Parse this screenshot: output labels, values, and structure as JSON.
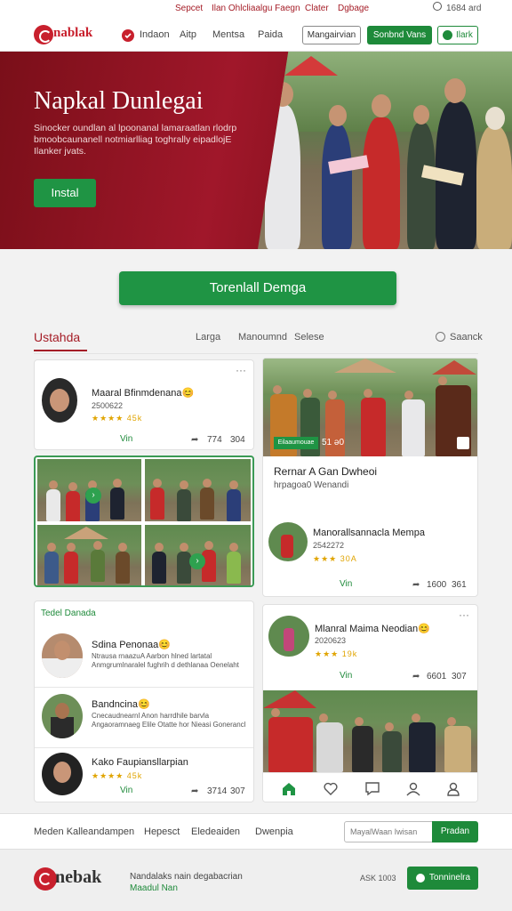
{
  "top_strip": {
    "links": [
      "Sepcet",
      "Ilan Ohlcliaalgu Faegn",
      "Clater",
      "Dgbage"
    ],
    "right_text": "1684 ard"
  },
  "nav": {
    "brand": "nablak",
    "items": [
      "Indaon",
      "Aitp",
      "Mentsa",
      "Paida"
    ],
    "outline_button": "Mangairvian",
    "green_button": "Sonbnd Vans",
    "green_outline_button": "Ilark"
  },
  "hero": {
    "title": "Napkal Dunlegai",
    "body": "Sinocker oundlan al lpoonanal lamaraatlan rlodrp bmoobcaunanell notmiarlliag toghrally eipadlojE Ilanker jvats.",
    "button": "Instal"
  },
  "cta": {
    "label": "Torenlall Demga"
  },
  "tabs": {
    "active": "Ustahda",
    "items": [
      "Larga",
      "Manoumnd",
      "Selese"
    ],
    "search": "Saanck"
  },
  "post_card_1": {
    "name": "Maaral Bfinmdenana😊",
    "sub": "2500622",
    "rating": "★★★★ 45k",
    "vin": "Vin",
    "stat1": "774",
    "stat2": "304"
  },
  "feature_card": {
    "badge": "Eilaaumouae",
    "badge_count": "51 ə0",
    "title": "Rernar A Gan Dwheoi",
    "subtitle": "hrpagoa0 Wenandi",
    "name": "Manorallsannacla Mempa",
    "sub": "2542272",
    "rating": "★★★ 30A",
    "vin": "Vin",
    "stat1": "1600",
    "stat2": "361"
  },
  "comments": {
    "title": "Tedel Danada",
    "items": [
      {
        "name": "Sdina Penonaa😊",
        "text": "Ntrausa rnaazuA Aarbon hlned lartatal Anmgrumlnaralel fughrih d dethlanaa Oenelaht"
      },
      {
        "name": "Bandncina😊",
        "text": "Cnecaudnearnl Anon harrdhile barvla Angaoramnaeg Elile Otatte hor Nieasi Gonerancl"
      },
      {
        "name": "Kako Faupiansllarpian",
        "rating": "★★★★ 45k",
        "vin": "Vin",
        "stat1": "3714",
        "stat2": "307"
      }
    ]
  },
  "post_card_2": {
    "name": "Mlanral Maima Neodian😊",
    "sub": "2020623",
    "rating": "★★★ 19k",
    "vin": "Vin",
    "stat1": "6601",
    "stat2": "307"
  },
  "subnav": {
    "items": [
      "Meden Kalleandampen",
      "Hepesct",
      "Eledeaiden",
      "Dwenpia"
    ],
    "input_placeholder": "MayalWaan Iwisan",
    "button": "Pradan"
  },
  "footer": {
    "brand": "nebak",
    "line1": "Nandalaks nain degabacrian",
    "line2": "Maadul Nan",
    "version": "ASK 1003",
    "button": "Tonninelra"
  },
  "colors": {
    "brand_red": "#c8202d",
    "accent_green": "#1f9444",
    "hero_dark": "#7a0f19"
  }
}
